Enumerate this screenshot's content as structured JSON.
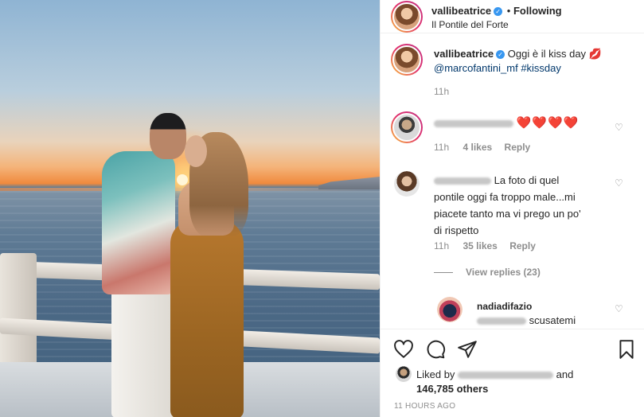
{
  "post": {
    "author": "vallibeatrice",
    "location": "Il Pontile del Forte",
    "follow_status": "Following",
    "caption_text": "Oggi è il kiss day",
    "caption_emoji": "💋",
    "caption_mention": "@marcofantini_mf",
    "caption_hashtag": "#kissday",
    "caption_time": "11h"
  },
  "comments": [
    {
      "username_obscured": true,
      "text": "❤️❤️❤️❤️",
      "time": "11h",
      "likes": "4 likes",
      "reply": "Reply"
    },
    {
      "username_obscured": true,
      "text_line1": "La foto di quel",
      "text_rest": "pontile oggi fa troppo male...mi piacete tanto ma vi prego un po' di rispetto",
      "time": "11h",
      "likes": "35 likes",
      "reply": "Reply",
      "view_replies": "View replies (23)"
    },
    {
      "username": "nadiadifazio",
      "text": "scusatemi"
    }
  ],
  "actions": {
    "liked_by_prefix": "Liked by",
    "liked_by_and": "and",
    "likes_count": "146,785 others",
    "timestamp": "11 HOURS AGO"
  },
  "icons": [
    "heart-icon",
    "comment-icon",
    "share-icon",
    "bookmark-icon",
    "verified-icon",
    "more-dot"
  ],
  "colors": {
    "verified": "#3897f0",
    "heart_red": "#ed4956",
    "link": "#00376b",
    "muted": "#8e8e8e"
  }
}
